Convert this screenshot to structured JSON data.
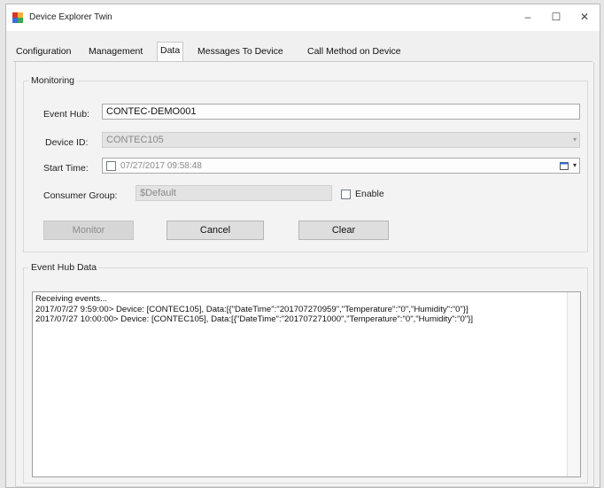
{
  "window": {
    "title": "Device Explorer Twin",
    "minimize_glyph": "–",
    "maximize_glyph": "☐",
    "close_glyph": "✕"
  },
  "tabs": [
    {
      "label": "Configuration",
      "active": false
    },
    {
      "label": "Management",
      "active": false
    },
    {
      "label": "Data",
      "active": true
    },
    {
      "label": "Messages To Device",
      "active": false
    },
    {
      "label": "Call Method on Device",
      "active": false
    }
  ],
  "monitoring": {
    "title": "Monitoring",
    "event_hub_label": "Event Hub:",
    "event_hub_value": "CONTEC-DEMO001",
    "device_id_label": "Device ID:",
    "device_id_value": "CONTEC105",
    "start_time_label": "Start Time:",
    "start_time_value": "07/27/2017 09:58:48",
    "consumer_group_label": "Consumer Group:",
    "consumer_group_value": "$Default",
    "enable_label": "Enable",
    "monitor_label": "Monitor",
    "cancel_label": "Cancel",
    "clear_label": "Clear"
  },
  "event_hub_data": {
    "title": "Event Hub Data",
    "lines": [
      "Receiving events...",
      "2017/07/27 9:59:00> Device: [CONTEC105], Data:[{\"DateTime\":\"201707270959\",\"Temperature\":\"0\",\"Humidity\":\"0\"}]",
      "2017/07/27 10:00:00> Device: [CONTEC105], Data:[{\"DateTime\":\"201707271000\",\"Temperature\":\"0\",\"Humidity\":\"0\"}]"
    ]
  },
  "icons": {
    "app": "app-icon",
    "device_dropdown": "chevron-down-icon",
    "calendar": "calendar-icon"
  },
  "colors": {
    "app_icon_red": "#d9362b",
    "app_icon_blue": "#3b6fd6",
    "calendar_blue": "#2f6fd8"
  }
}
